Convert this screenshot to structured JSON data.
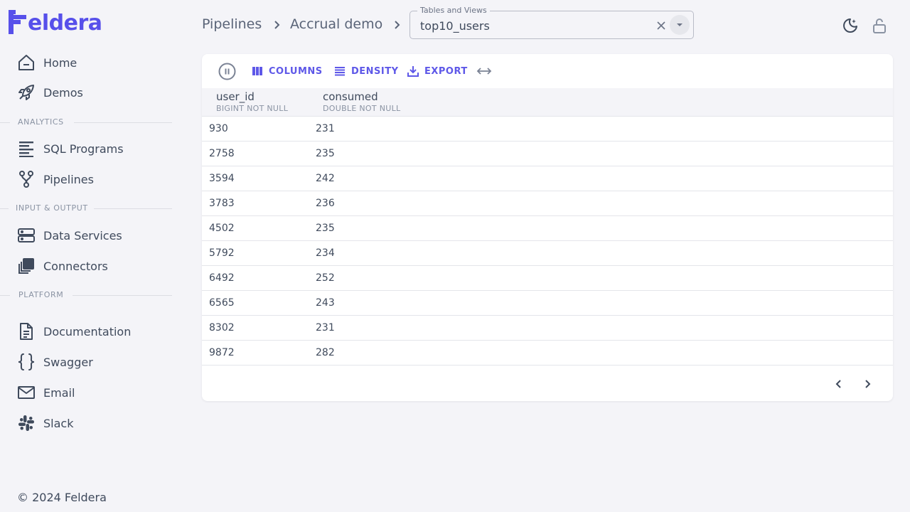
{
  "brand": {
    "name": "eldera",
    "color": "#5750ea"
  },
  "sidebar": {
    "items": [
      {
        "label": "Home",
        "icon": "home-icon"
      },
      {
        "label": "Demos",
        "icon": "rocket-icon"
      },
      {
        "label": "SQL Programs",
        "icon": "text-lines-icon"
      },
      {
        "label": "Pipelines",
        "icon": "fork-icon"
      },
      {
        "label": "Data Services",
        "icon": "server-icon"
      },
      {
        "label": "Connectors",
        "icon": "layers-icon"
      },
      {
        "label": "Documentation",
        "icon": "document-icon"
      },
      {
        "label": "Swagger",
        "icon": "braces-icon"
      },
      {
        "label": "Email",
        "icon": "mail-icon"
      },
      {
        "label": "Slack",
        "icon": "slack-icon"
      }
    ],
    "sections": [
      "ANALYTICS",
      "INPUT & OUTPUT",
      "PLATFORM"
    ],
    "copyright": "© 2024 Feldera"
  },
  "header": {
    "breadcrumbs": [
      "Pipelines",
      "Accrual demo"
    ],
    "tables_views": {
      "label": "Tables and Views",
      "value": "top10_users"
    }
  },
  "toolbar": {
    "columns_label": "COLUMNS",
    "density_label": "DENSITY",
    "export_label": "EXPORT"
  },
  "table": {
    "columns": [
      {
        "name": "user_id",
        "type": "BIGINT NOT NULL"
      },
      {
        "name": "consumed",
        "type": "DOUBLE NOT NULL"
      }
    ],
    "rows": [
      [
        "930",
        "231"
      ],
      [
        "2758",
        "235"
      ],
      [
        "3594",
        "242"
      ],
      [
        "3783",
        "236"
      ],
      [
        "4502",
        "235"
      ],
      [
        "5792",
        "234"
      ],
      [
        "6492",
        "252"
      ],
      [
        "6565",
        "243"
      ],
      [
        "8302",
        "231"
      ],
      [
        "9872",
        "282"
      ]
    ]
  },
  "colors": {
    "accent": "#5e58e8",
    "text": "#3f4a5c",
    "background": "#f4f4f8"
  }
}
